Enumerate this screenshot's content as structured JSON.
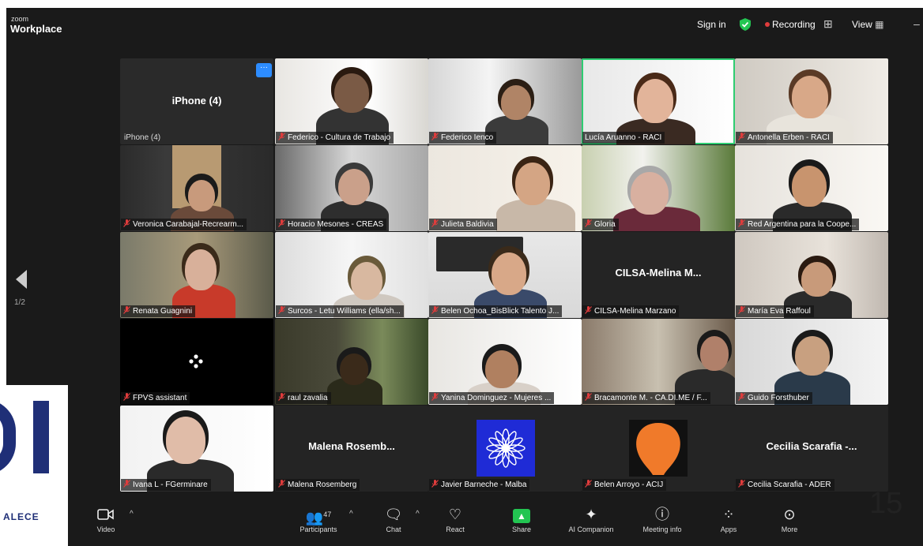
{
  "window": {
    "brand_small": "zoom",
    "brand_big": "Workplace",
    "sign_in": "Sign in",
    "recording": "Recording",
    "view": "View"
  },
  "pager": {
    "text": "1/2"
  },
  "tiles": [
    {
      "name": "iPhone (4)",
      "center": "iPhone (4)",
      "sub": "iPhone (4)",
      "muted": false,
      "video": false
    },
    {
      "name": "Federico - Cultura de Trabajo",
      "muted": true,
      "video": true
    },
    {
      "name": "Federico Ienco",
      "muted": true,
      "video": true
    },
    {
      "name": "Lucía Aruanno - RACI",
      "muted": false,
      "video": true,
      "speaking": true
    },
    {
      "name": "Antonella Erben - RACI",
      "muted": true,
      "video": true
    },
    {
      "name": "Veronica Carabajal-Recrearm...",
      "muted": true,
      "video": true
    },
    {
      "name": "Horacio Mesones - CREAS",
      "muted": true,
      "video": true
    },
    {
      "name": "Julieta Baldivia",
      "muted": true,
      "video": true
    },
    {
      "name": "Gloria",
      "muted": true,
      "video": true
    },
    {
      "name": "Red Argentina para la Coope...",
      "muted": true,
      "video": true
    },
    {
      "name": "Renata Guagnini",
      "muted": true,
      "video": true
    },
    {
      "name": "Surcos - Letu Williams (ella/sh...",
      "muted": true,
      "video": true
    },
    {
      "name": "Belen Ochoa_BisBlick Talento J...",
      "muted": true,
      "video": true
    },
    {
      "name": "CILSA-Melina Marzano",
      "center": "CILSA-Melina  M...",
      "muted": true,
      "video": false
    },
    {
      "name": "María Eva Raffoul",
      "muted": true,
      "video": true
    },
    {
      "name": "FPVS assistant",
      "muted": true,
      "video": false
    },
    {
      "name": "raul zavalia",
      "muted": true,
      "video": true
    },
    {
      "name": "Yanina Dominguez - Mujeres ...",
      "muted": true,
      "video": true
    },
    {
      "name": "Bracamonte M. - CA.DI.ME / F...",
      "muted": true,
      "video": true
    },
    {
      "name": "Guido Forsthuber",
      "muted": true,
      "video": true
    },
    {
      "name": "Ivana L - FGerminare",
      "muted": true,
      "video": true
    },
    {
      "name": "Malena Rosemberg",
      "center": "Malena  Rosemb...",
      "muted": true,
      "video": false
    },
    {
      "name": "Javier Barneche - Malba",
      "muted": true,
      "video": false
    },
    {
      "name": "Belen Arroyo - ACIJ",
      "muted": true,
      "video": false
    },
    {
      "name": "Cecilia Scarafia - ADER",
      "center": "Cecilia  Scarafia  -...",
      "muted": true,
      "video": false
    }
  ],
  "toolbar": {
    "video": "Video",
    "participants": "Participants",
    "participants_count": "47",
    "chat": "Chat",
    "react": "React",
    "share": "Share",
    "ai_companion": "AI Companion",
    "meeting_info": "Meeting info",
    "apps": "Apps",
    "more": "More"
  },
  "overlay": {
    "page_number": "15",
    "logo_text": "ALECE"
  },
  "colors": {
    "background": "#1a1a1a",
    "tile": "#242424",
    "speaking_outline": "#2ecc71",
    "recording": "#e03c3c",
    "share": "#23c552",
    "accent": "#2d8cff",
    "logo": "#1f2f77"
  }
}
